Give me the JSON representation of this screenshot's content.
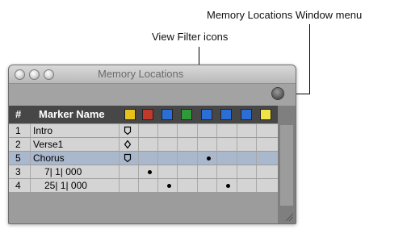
{
  "callouts": {
    "menu_label": "Memory Locations Window menu",
    "filter_label": "View Filter icons"
  },
  "window": {
    "title": "Memory Locations"
  },
  "columns": {
    "number": "#",
    "marker_name": "Marker Name"
  },
  "filter_icons": [
    {
      "name": "marker-filter-icon",
      "color": "#e8c21a"
    },
    {
      "name": "selection-filter-icon",
      "color": "#c0392b"
    },
    {
      "name": "zoom-filter-icon",
      "color": "#2b6fd6"
    },
    {
      "name": "pre-post-roll-filter-icon",
      "color": "#2e9a3a"
    },
    {
      "name": "track-show-hide-filter-icon",
      "color": "#2b6fd6"
    },
    {
      "name": "track-height-filter-icon",
      "color": "#2b6fd6"
    },
    {
      "name": "group-enables-filter-icon",
      "color": "#2b6fd6"
    },
    {
      "name": "window-config-filter-icon",
      "color": "#f0e34a"
    }
  ],
  "rows": [
    {
      "num": "1",
      "name": "Intro",
      "type_icon": "marker",
      "dots": [],
      "selected": false
    },
    {
      "num": "2",
      "name": "Verse1",
      "type_icon": "selection",
      "dots": [],
      "selected": false
    },
    {
      "num": "5",
      "name": "Chorus",
      "type_icon": "marker",
      "dots": [
        3
      ],
      "selected": true
    },
    {
      "num": "3",
      "name": "7| 1| 000",
      "type_icon": "",
      "dots": [
        0
      ],
      "selected": false
    },
    {
      "num": "4",
      "name": "25| 1| 000",
      "type_icon": "",
      "dots": [
        1,
        4
      ],
      "selected": false
    }
  ],
  "colors": {
    "header_bg": "#474747",
    "selected_row": "#a9b8cd",
    "row_bg": "#d4d4d4"
  }
}
